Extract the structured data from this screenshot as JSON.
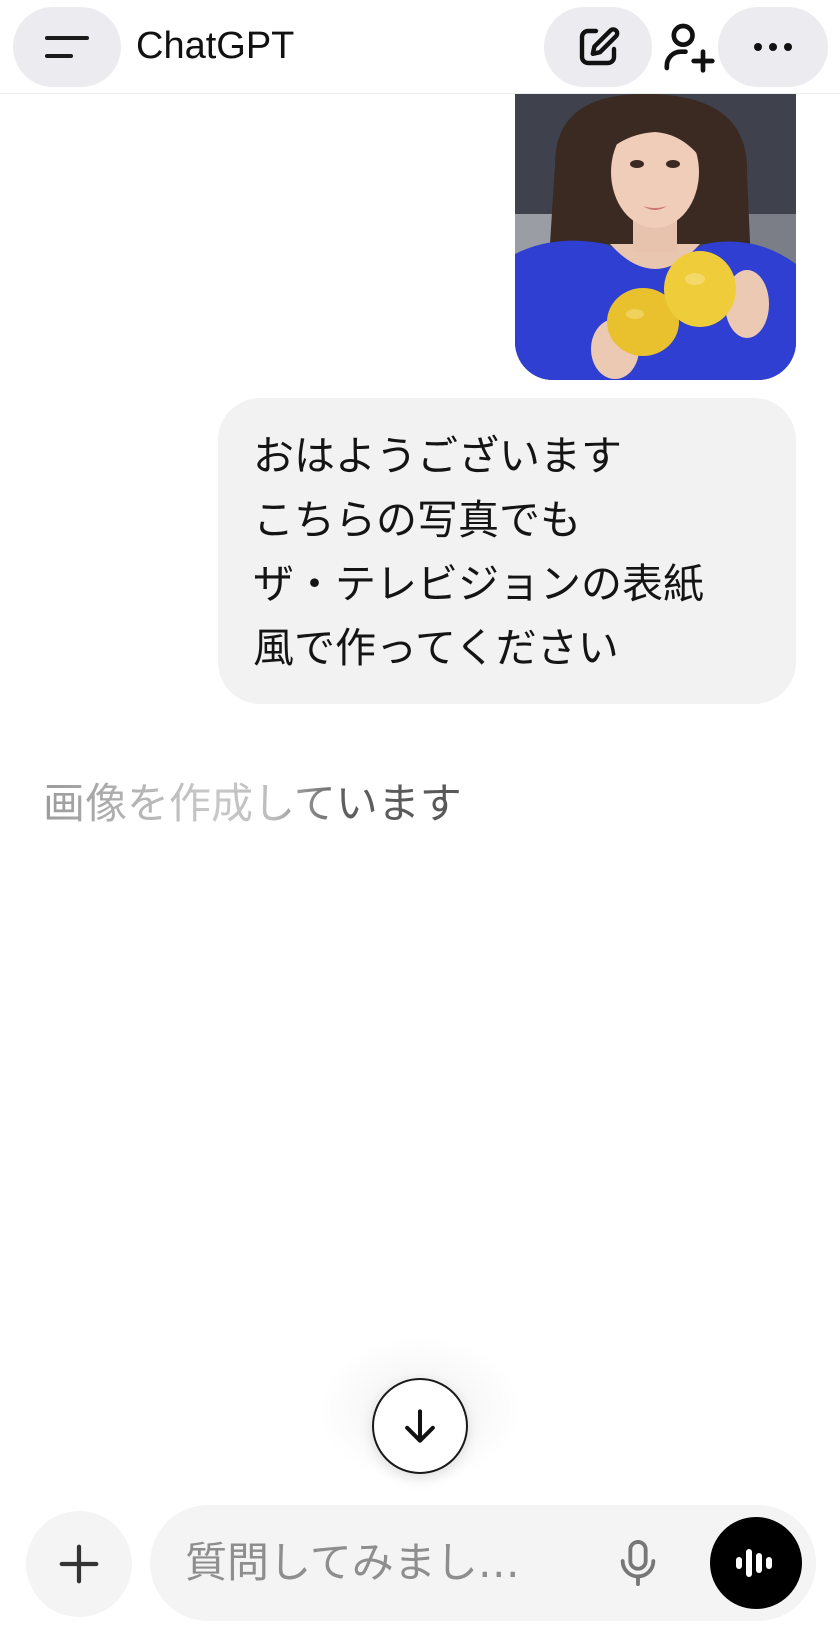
{
  "header": {
    "title": "ChatGPT",
    "icons": {
      "menu": "menu-icon",
      "new_chat": "edit-icon",
      "add_user": "add-user-icon",
      "more": "more-icon"
    }
  },
  "conversation": {
    "user_image": "user-photo",
    "user_message": {
      "lines": [
        "おはようございます",
        "こちらの写真でも",
        "ザ・テレビジョンの表紙",
        "風で作ってください"
      ]
    },
    "assistant_status": "画像を作成しています"
  },
  "scroll_button": {
    "icon": "arrow-down-icon"
  },
  "composer": {
    "placeholder": "質問してみまし…",
    "icons": {
      "plus": "plus-icon",
      "mic": "mic-icon",
      "voice": "voice-mode-icon"
    }
  },
  "colors": {
    "bubble_bg": "#f2f2f2",
    "header_pill": "#ececf0",
    "composer_bg": "#f4f4f4",
    "voice_button": "#000000"
  }
}
